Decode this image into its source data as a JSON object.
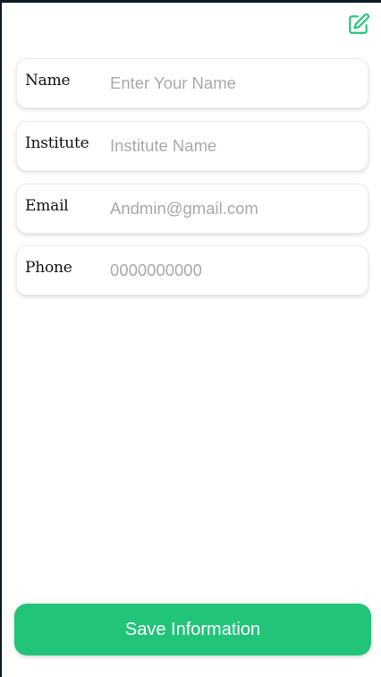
{
  "header": {
    "edit_icon": "edit-square-icon",
    "accent_color": "#22c47a"
  },
  "form": {
    "fields": [
      {
        "label": "Name",
        "placeholder": "Enter Your Name",
        "value": ""
      },
      {
        "label": "Institute",
        "placeholder": "Institute Name",
        "value": ""
      },
      {
        "label": "Email",
        "placeholder": "Andmin@gmail.com",
        "value": ""
      },
      {
        "label": "Phone",
        "placeholder": "0000000000",
        "value": ""
      }
    ]
  },
  "footer": {
    "save_label": "Save Information",
    "button_color": "#22c47a"
  }
}
